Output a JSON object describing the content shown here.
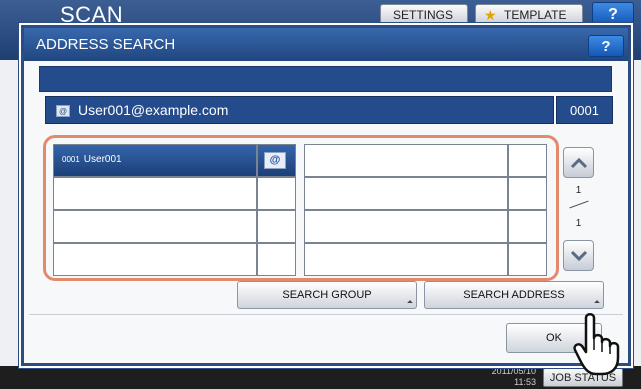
{
  "background": {
    "title": "SCAN",
    "settings_label": "SETTINGS",
    "template_label": "TEMPLATE",
    "help_label": "?",
    "footer_date": "2011/05/10",
    "footer_time": "11:53",
    "job_status_label": "JOB STATUS"
  },
  "dialog": {
    "title": "ADDRESS SEARCH",
    "help_label": "?",
    "selected_address": "User001@example.com",
    "selected_number": "0001"
  },
  "grid": {
    "left": [
      {
        "num": "0001",
        "name": "User001",
        "has_email": true,
        "selected": true
      },
      {
        "num": "",
        "name": "",
        "has_email": false,
        "selected": false
      },
      {
        "num": "",
        "name": "",
        "has_email": false,
        "selected": false
      },
      {
        "num": "",
        "name": "",
        "has_email": false,
        "selected": false
      }
    ],
    "right": [
      {
        "num": "",
        "name": ""
      },
      {
        "num": "",
        "name": ""
      },
      {
        "num": "",
        "name": ""
      },
      {
        "num": "",
        "name": ""
      }
    ]
  },
  "pager": {
    "current": "1",
    "total": "1"
  },
  "buttons": {
    "search_group": "SEARCH GROUP",
    "search_address": "SEARCH ADDRESS",
    "ok": "OK"
  },
  "icons": {
    "email": "email-icon",
    "at": "at-icon",
    "up": "arrow-up-icon",
    "down": "arrow-down-icon",
    "cursor": "hand-pointer-icon"
  },
  "colors": {
    "accent": "#244c8c",
    "highlight": "#e38a6d"
  }
}
